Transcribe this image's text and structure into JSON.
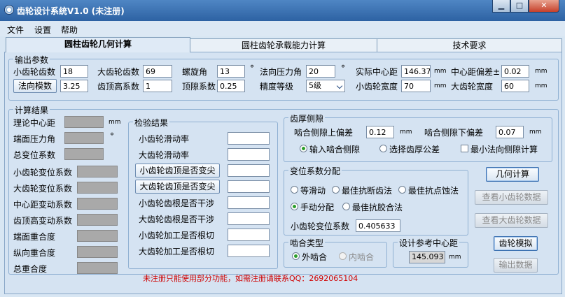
{
  "window": {
    "title": "齿轮设计系统V1.0 (未注册)"
  },
  "menu": [
    "文件",
    "设置",
    "帮助"
  ],
  "tabs": [
    "圆柱齿轮几何计算",
    "圆柱齿轮承载能力计算",
    "技术要求"
  ],
  "output_params": {
    "legend": "输出参数",
    "z1_label": "小齿轮齿数",
    "z1": "18",
    "z2_label": "大齿轮齿数",
    "z2": "69",
    "helix_label": "螺旋角",
    "helix": "13",
    "deg": "°",
    "pressure_label": "法向压力角",
    "pressure": "20",
    "center_label": "实际中心距",
    "center": "146.37",
    "mm": "mm",
    "center_dev_label": "中心距偏差±",
    "center_dev": "0.02",
    "module_button": "法向模数",
    "module": "3.25",
    "addendum_label": "齿顶高系数",
    "addendum": "1",
    "tip_label": "顶隙系数",
    "tip": "0.25",
    "grade_label": "精度等级",
    "grade": "5级",
    "w1_label": "小齿轮宽度",
    "w1": "70",
    "w2_label": "大齿轮宽度",
    "w2": "60"
  },
  "calc_results": {
    "legend": "计算结果",
    "rows": [
      "理论中心距",
      "端面压力角",
      "总变位系数",
      "小齿轮变位系数",
      "大齿轮变位系数",
      "中心距变动系数",
      "齿顶高变动系数",
      "端面重合度",
      "纵向重合度",
      "总重合度"
    ],
    "unit_mm": "mm",
    "unit_deg": "°"
  },
  "check_results": {
    "legend": "检验结果",
    "rows": [
      "小齿轮滑动率",
      "大齿轮滑动率",
      "小齿轮齿顶是否变尖",
      "大齿轮齿顶是否变尖",
      "小齿轮齿根是否干涉",
      "大齿轮齿根是否干涉",
      "小齿轮加工是否根切",
      "大齿轮加工是否根切"
    ]
  },
  "backlash": {
    "legend": "齿厚侧隙",
    "upper_label": "啮合侧隙上偏差",
    "upper": "0.12",
    "lower_label": "啮合侧隙下偏差",
    "lower": "0.07",
    "mm": "mm",
    "opt_input": "输入啮合侧隙",
    "opt_tolerance": "选择齿厚公差",
    "opt_min": "最小法向侧隙计算"
  },
  "shift": {
    "legend": "变位系数分配",
    "opt1": "等滑动",
    "opt2": "最佳抗断齿法",
    "opt3": "最佳抗点蚀法",
    "opt4": "手动分配",
    "opt5": "最佳抗胶合法",
    "x1_label": "小齿轮变位系数",
    "x1": "0.405633"
  },
  "mesh": {
    "legend": "啮合类型",
    "ext": "外啮合",
    "int": "内啮合"
  },
  "ref_center": {
    "legend": "设计参考中心距",
    "value": "145.093",
    "mm": "mm"
  },
  "buttons": {
    "geom": "几何计算",
    "view_small": "查看小齿轮数据",
    "view_big": "查看大齿轮数据",
    "sim": "齿轮模拟",
    "export": "输出数据"
  },
  "notice": "未注册只能使用部分功能，如需注册请联系QQ：2692065104"
}
